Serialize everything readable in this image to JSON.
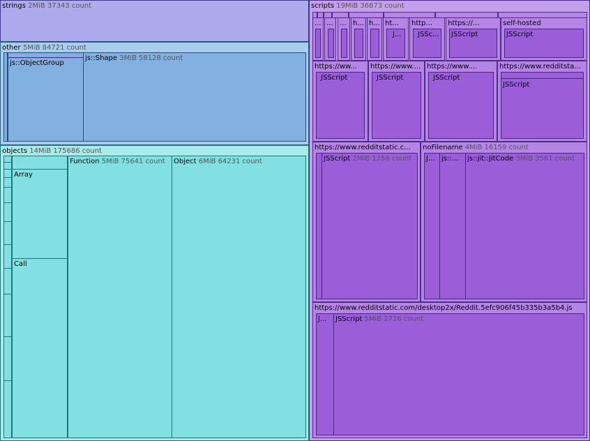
{
  "strings": {
    "name": "strings",
    "meta": "2MiB 37343 count"
  },
  "other": {
    "name": "other",
    "meta": "5MiB 84721 count",
    "object_group": {
      "name": "js::ObjectGroup"
    },
    "shape": {
      "name": "js::Shape",
      "meta": "3MiB 58128 count"
    }
  },
  "objects": {
    "name": "objects",
    "meta": "14MiB 175686 count",
    "array": {
      "name": "Array"
    },
    "call": {
      "name": "Call"
    },
    "function": {
      "name": "Function",
      "meta": "5MiB 75641 count"
    },
    "object": {
      "name": "Object",
      "meta": "6MiB 64231 count"
    }
  },
  "scripts": {
    "name": "scripts",
    "meta": "19MiB 36873 count",
    "row1": [
      {
        "name": "..."
      },
      {
        "name": "..."
      },
      {
        "name": "..."
      },
      {
        "name": "h..."
      },
      {
        "name": "h..."
      },
      {
        "name": "ht...",
        "child": "J..."
      },
      {
        "name": "http...",
        "child": "JSSc..."
      },
      {
        "name": "https://...",
        "child": "JSScript"
      },
      {
        "name": "self-hosted",
        "child": "JSScript"
      }
    ],
    "row2": [
      {
        "name": "https://ww...",
        "child": "JSScript"
      },
      {
        "name": "https://www....",
        "child": "JSScript"
      },
      {
        "name": "https://www....",
        "child": "JSScript"
      },
      {
        "name": "https://www.redditsta...",
        "child": "JSScript"
      }
    ],
    "row3a": {
      "name": "https://www.redditstatic.c...",
      "child": {
        "name": "JSScript",
        "meta": "2MiB 1258 count"
      }
    },
    "row3b": {
      "name": "noFilename",
      "meta": "4MiB 16159 count",
      "children": [
        {
          "name": "J..."
        },
        {
          "name": "js::..."
        },
        {
          "name": "js::jit::JitCode",
          "meta": "3MiB 3561 count"
        }
      ]
    },
    "row4": {
      "name": "https://www.redditstatic.com/desktop2x/Reddit.5efc906f45b335b3a5b4.js",
      "small": {
        "name": "J..."
      },
      "big": {
        "name": "JSScript",
        "meta": "5MiB 2726 count"
      }
    }
  }
}
